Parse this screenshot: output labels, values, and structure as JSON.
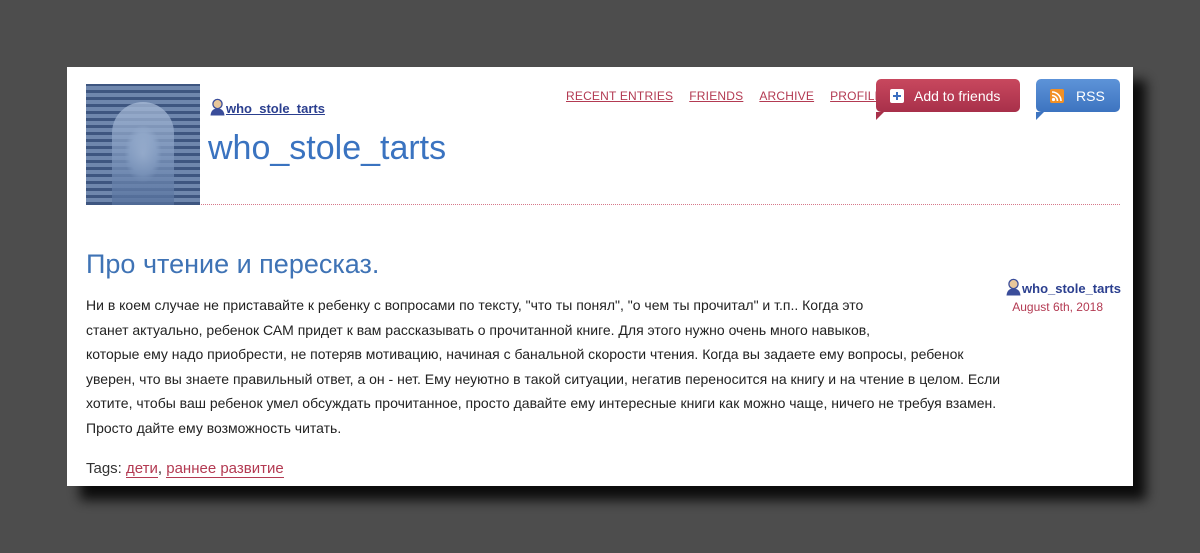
{
  "header": {
    "journal_user": "who_stole_tarts",
    "journal_title": "who_stole_tarts"
  },
  "nav": {
    "items": [
      "RECENT ENTRIES",
      "FRIENDS",
      "ARCHIVE",
      "PROFILE"
    ]
  },
  "buttons": {
    "add_to_friends": "Add to friends",
    "rss": "RSS"
  },
  "entry": {
    "title": "Про чтение и пересказ.",
    "poster": "who_stole_tarts",
    "date": "August 6th, 2018",
    "lines": [
      "Ни в коем случае не приставайте к ребенку с вопросами по тексту, \"что ты понял\", \"о чем ты прочитал\" и т.п.. Когда это",
      "станет актуально, ребенок САМ придет к вам рассказывать о прочитанной книге. Для этого нужно очень много навыков,",
      "которые ему надо приобрести, не потеряв мотивацию, начиная с банальной скорости чтения. Когда вы задаете ему вопросы, ребенок",
      "уверен, что вы знаете правильный ответ, а он - нет. Ему неуютно в такой ситуации, негатив переносится на книгу и на чтение в целом. Если",
      "хотите, чтобы ваш ребенок умел обсуждать прочитанное, просто давайте ему интересные книги как можно чаще, ничего не требуя взамен.",
      "Просто дайте ему возможность читать."
    ]
  },
  "tags": {
    "label": "Tags:",
    "items": [
      "дети",
      "раннее развитие"
    ],
    "separator": ","
  },
  "colors": {
    "accent": "#b33a52",
    "title_blue": "#3a73c0",
    "add_button": "#b8374f",
    "rss_button": "#4a82cc"
  }
}
